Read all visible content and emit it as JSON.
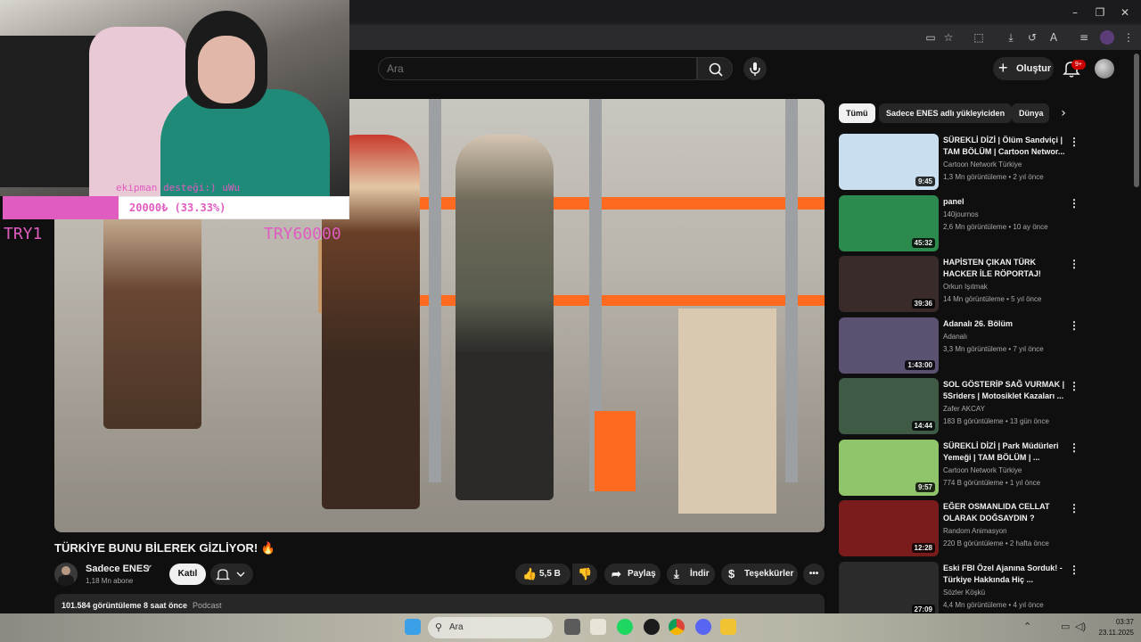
{
  "browser": {
    "window_controls": [
      "–",
      "❐",
      "✕"
    ]
  },
  "search": {
    "placeholder": "Ara"
  },
  "masthead": {
    "create_label": "Oluştur",
    "notification_badge": "9+"
  },
  "overlay": {
    "donation_title": "ekipman desteği:) uWu",
    "donation_amount": "20000₺ (33.33%)",
    "donation_progress": 0.3333,
    "min_label": "TRY1",
    "max_label": "TRY60000"
  },
  "video": {
    "title": "TÜRKİYE BUNU BİLEREK GİZLİYOR! 🔥",
    "channel": "Sadece ENES",
    "subscribers": "1,18 Mn abone",
    "join_label": "Katıl",
    "likes": "5,5 B",
    "share_label": "Paylaş",
    "download_label": "İndir",
    "thanks_label": "Teşekkürler",
    "views_time": "101.584 görüntüleme  8 saat önce",
    "tag": "Podcast"
  },
  "chips": [
    "Tümü",
    "Sadece ENES adlı yükleyiciden",
    "Dünya"
  ],
  "recommendations": [
    {
      "title": "SÜREKLİ DİZİ | Ölüm Sandviçi | TAM BÖLÜM | Cartoon Networ...",
      "channel": "Cartoon Network Türkiye",
      "meta": "1,3 Mn görüntüleme • 2 yıl önce",
      "duration": "9:45",
      "thumb_color": "#c9dff0"
    },
    {
      "title": "panel",
      "channel": "140journos",
      "meta": "2,6 Mn görüntüleme • 10 ay önce",
      "duration": "45:32",
      "thumb_color": "#2d8a4e"
    },
    {
      "title": "HAPİSTEN ÇIKAN TÜRK HACKER İLE RÖPORTAJ!",
      "channel": "Orkun Işıtmak",
      "meta": "14 Mn görüntüleme • 5 yıl önce",
      "duration": "39:36",
      "thumb_color": "#3a2b2b"
    },
    {
      "title": "Adanalı 26. Bölüm",
      "channel": "Adanalı",
      "meta": "3,3 Mn görüntüleme • 7 yıl önce",
      "duration": "1:43:00",
      "thumb_color": "#5a5270"
    },
    {
      "title": "SOL GÖSTERİP SAĞ VURMAK | 5Sriders | Motosiklet Kazaları ...",
      "channel": "Zafer AKCAY",
      "meta": "183 B görüntüleme • 13 gün önce",
      "duration": "14:44",
      "thumb_color": "#3f5a45"
    },
    {
      "title": "SÜREKLİ DİZİ | Park Müdürleri Yemeği | TAM BÖLÜM | ...",
      "channel": "Cartoon Network Türkiye",
      "meta": "774 B görüntüleme • 1 yıl önce",
      "duration": "9:57",
      "thumb_color": "#8fc46a"
    },
    {
      "title": "EĞER OSMANLIDA CELLAT OLARAK DOĞSAYDIN ?",
      "channel": "Random Animasyon",
      "meta": "220 B görüntüleme • 2 hafta önce",
      "duration": "12:28",
      "thumb_color": "#7a1c1c"
    },
    {
      "title": "Eski FBI Özel Ajanına Sorduk! - Türkiye Hakkında Hiç ...",
      "channel": "Sözler Köşkü",
      "meta": "4,4 Mn görüntüleme • 4 yıl önce",
      "duration": "27:09",
      "thumb_color": "#2b2b2b"
    }
  ],
  "taskbar": {
    "search_placeholder": "Ara",
    "time": "03:37",
    "date": "23.11.2025"
  },
  "colors": {
    "accent_pink": "#e05cc0",
    "youtube_red": "#cc0000",
    "background": "#0f0f0f"
  }
}
